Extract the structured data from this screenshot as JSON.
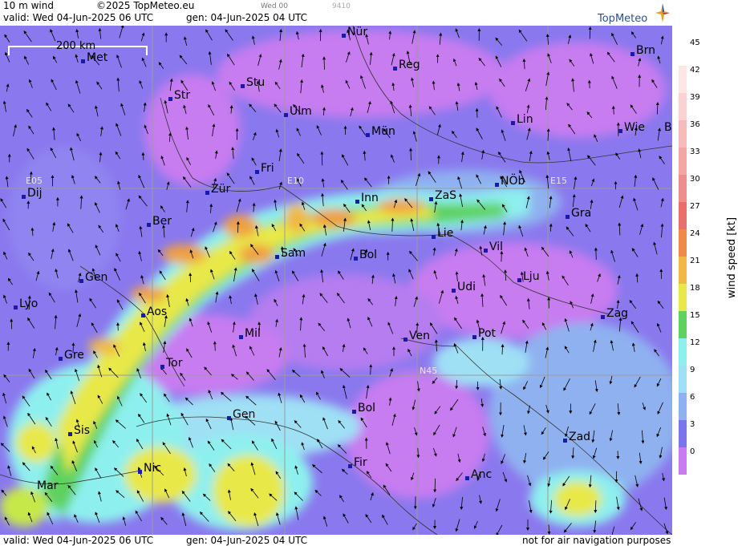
{
  "header": {
    "product": "10 m wind",
    "copyright": "©2025 TopMeteo.eu",
    "valid": "valid:  Wed  04-Jun-2025  06 UTC",
    "gen": "gen: 04-Jun-2025 04 UTC",
    "timestamp_small": "Wed 00",
    "id_small": "9410"
  },
  "footer": {
    "valid": "valid:  Wed  04-Jun-2025  06 UTC",
    "gen": "gen: 04-Jun-2025 04 UTC",
    "disclaimer": "not for air navigation purposes"
  },
  "logo": {
    "text": "TopMeteo"
  },
  "scalebar": {
    "label": "200 km"
  },
  "grid_labels": [
    "E05",
    "E10",
    "E15",
    "N45"
  ],
  "cities": [
    {
      "name": "Nür"
    },
    {
      "name": "Met"
    },
    {
      "name": "Reg"
    },
    {
      "name": "Brn"
    },
    {
      "name": "Stu"
    },
    {
      "name": "Str"
    },
    {
      "name": "Ulm"
    },
    {
      "name": "Lin"
    },
    {
      "name": "Mün"
    },
    {
      "name": "Wie"
    },
    {
      "name": "B"
    },
    {
      "name": "Fri"
    },
    {
      "name": "NÖb"
    },
    {
      "name": "Dij"
    },
    {
      "name": "Zür"
    },
    {
      "name": "Inn"
    },
    {
      "name": "ZaS"
    },
    {
      "name": "Gra"
    },
    {
      "name": "Ber"
    },
    {
      "name": "Lie"
    },
    {
      "name": "Vil"
    },
    {
      "name": "Sam"
    },
    {
      "name": "Bol"
    },
    {
      "name": "Lju"
    },
    {
      "name": "Gen"
    },
    {
      "name": "Udi"
    },
    {
      "name": "Lyo"
    },
    {
      "name": "Aos"
    },
    {
      "name": "Zag"
    },
    {
      "name": "Mil"
    },
    {
      "name": "Ven"
    },
    {
      "name": "Pot"
    },
    {
      "name": "Gre"
    },
    {
      "name": "Tor"
    },
    {
      "name": "Gen"
    },
    {
      "name": "Bol"
    },
    {
      "name": "Sis"
    },
    {
      "name": "Zad"
    },
    {
      "name": "Nic"
    },
    {
      "name": "Fir"
    },
    {
      "name": "Anc"
    },
    {
      "name": "Mar"
    }
  ],
  "colorbar": {
    "label": "wind speed  [kt]",
    "ticks": [
      "45",
      "42",
      "39",
      "36",
      "33",
      "30",
      "27",
      "24",
      "21",
      "18",
      "15",
      "12",
      "9",
      "6",
      "3",
      "0"
    ],
    "colors": [
      "#ffffff",
      "#fde6e6",
      "#fbd2d2",
      "#f6bcbc",
      "#f2a6a6",
      "#ee8f8f",
      "#e96f6f",
      "#f08a4a",
      "#f0b845",
      "#e8e84a",
      "#5fd15f",
      "#8ef0ee",
      "#9fe0f5",
      "#8fb1f0",
      "#7a75ee",
      "#c77cf0"
    ]
  }
}
